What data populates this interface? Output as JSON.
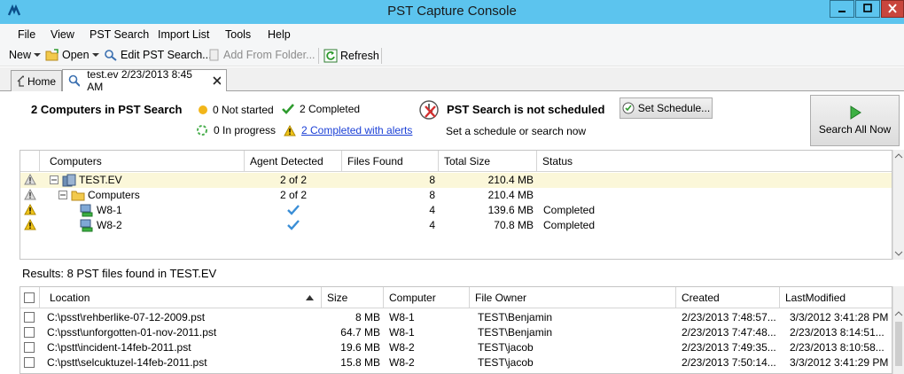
{
  "window": {
    "title": "PST Capture Console"
  },
  "menu": [
    "File",
    "View",
    "PST Search",
    "Import List",
    "Tools",
    "Help"
  ],
  "toolbar": {
    "new_label": "New",
    "open_label": "Open",
    "edit_label": "Edit PST Search...",
    "add_folder_label": "Add From Folder...",
    "refresh_label": "Refresh"
  },
  "tabs": [
    {
      "label": "Home"
    },
    {
      "label": "test.ev 2/23/2013 8:45 AM"
    }
  ],
  "summary": {
    "heading": "2 Computers in PST Search",
    "not_started": "0 Not started",
    "completed": "2 Completed",
    "in_progress": "0 In progress",
    "completed_alerts": "2 Completed with alerts",
    "schedule_title": "PST Search is not scheduled",
    "schedule_sub": "Set a schedule or search now",
    "set_schedule_label": "Set Schedule...",
    "search_all_label": "Search All Now",
    "colors": {
      "not_started": "#f2b61a",
      "completed": "#2e9b2e",
      "alert": "#f0c419"
    }
  },
  "computers_grid": {
    "headers": [
      "Computers",
      "Agent Detected",
      "Files Found",
      "Total Size",
      "Status"
    ],
    "rows": [
      {
        "name": "TEST.EV",
        "agent": "2 of 2",
        "files": "8",
        "size": "210.4 MB",
        "status": ""
      },
      {
        "name": "Computers",
        "agent": "2 of 2",
        "files": "8",
        "size": "210.4 MB",
        "status": ""
      },
      {
        "name": "W8-1",
        "agent": "check-icon",
        "files": "4",
        "size": "139.6 MB",
        "status": "Completed"
      },
      {
        "name": "W8-2",
        "agent": "check-icon",
        "files": "4",
        "size": "70.8 MB",
        "status": "Completed"
      }
    ]
  },
  "results": {
    "label": "Results: 8 PST files found in TEST.EV",
    "headers": [
      "Location",
      "Size",
      "Computer",
      "File Owner",
      "Created",
      "LastModified"
    ],
    "rows": [
      {
        "location": "C:\\psst\\rehberlike-07-12-2009.pst",
        "size": "8 MB",
        "computer": "W8-1",
        "owner": "TEST\\Benjamin",
        "created": "2/23/2013  7:48:57...",
        "modified": "3/3/2012  3:41:28 PM"
      },
      {
        "location": "C:\\psst\\unforgotten-01-nov-2011.pst",
        "size": "64.7 MB",
        "computer": "W8-1",
        "owner": "TEST\\Benjamin",
        "created": "2/23/2013  7:47:48...",
        "modified": "2/23/2013  8:14:51..."
      },
      {
        "location": "C:\\pstt\\incident-14feb-2011.pst",
        "size": "19.6 MB",
        "computer": "W8-2",
        "owner": "TEST\\jacob",
        "created": "2/23/2013  7:49:35...",
        "modified": "2/23/2013  8:10:58..."
      },
      {
        "location": "C:\\pstt\\selcuktuzel-14feb-2011.pst",
        "size": "15.8 MB",
        "computer": "W8-2",
        "owner": "TEST\\jacob",
        "created": "2/23/2013  7:50:14...",
        "modified": "3/3/2012  3:41:29 PM"
      }
    ]
  }
}
